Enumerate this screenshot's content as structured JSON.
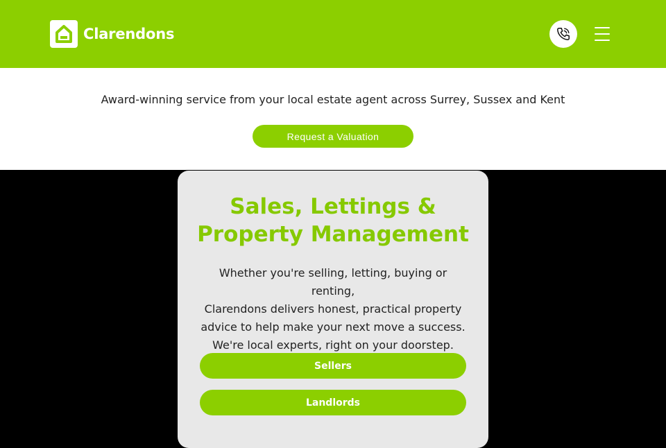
{
  "header": {
    "brand": "Clarendons",
    "logo_icon": "house-icon",
    "phone_icon": "phone-icon",
    "menu_icon": "hamburger-menu-icon"
  },
  "intro": {
    "tagline": "Award-winning service from your local estate agent across Surrey, Sussex and Kent",
    "valuation_button": "Request a Valuation"
  },
  "card": {
    "title_line1": "Sales, Lettings &",
    "title_line2": "Property Management",
    "body_lines": [
      "Whether you're selling, letting, buying or renting,",
      "Clarendons delivers honest, practical property",
      "advice to help make your next move a success.",
      "We're local experts, right on your doorstep."
    ],
    "buttons": [
      "Sellers",
      "Landlords"
    ]
  },
  "colors": {
    "brand_green": "#8ccf00",
    "title_green": "#86c900",
    "card_bg": "#e8e8e8"
  }
}
